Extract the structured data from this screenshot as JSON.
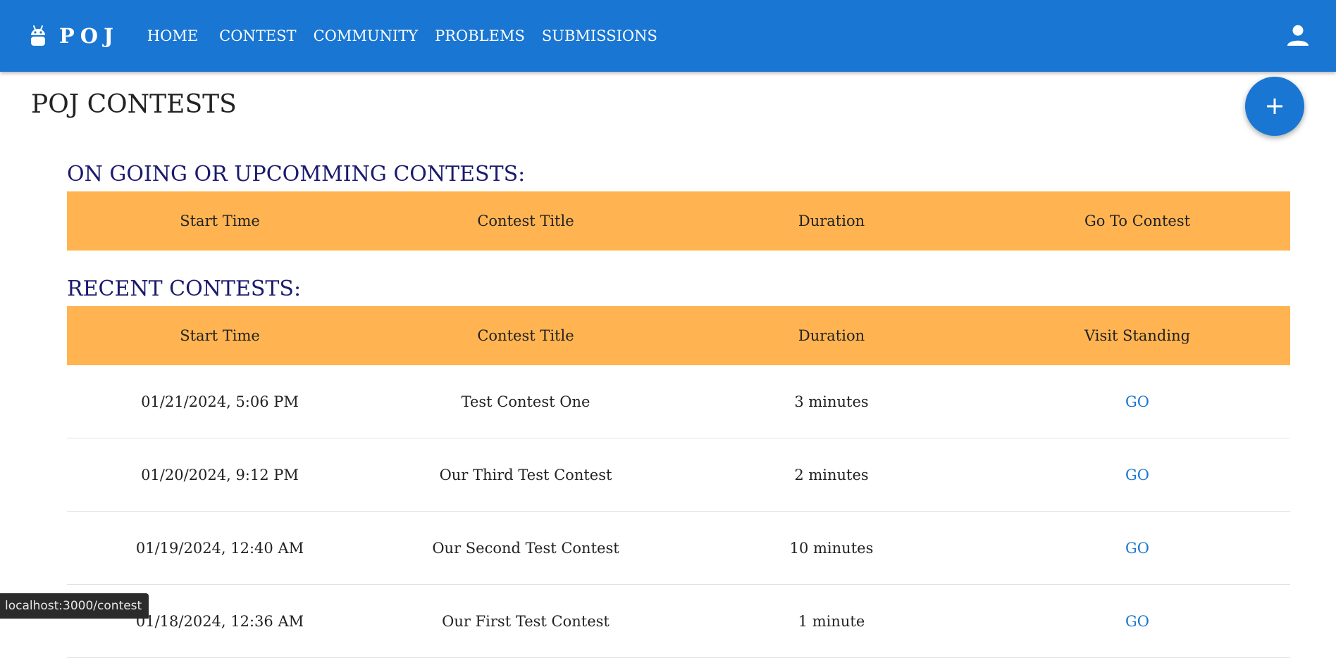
{
  "header": {
    "brand": "POJ",
    "nav": [
      "HOME",
      "CONTEST",
      "COMMUNITY",
      "PROBLEMS",
      "SUBMISSIONS"
    ]
  },
  "page": {
    "title": "POJ CONTESTS"
  },
  "upcoming": {
    "heading": "ON GOING OR UPCOMMING CONTESTS:",
    "columns": [
      "Start Time",
      "Contest Title",
      "Duration",
      "Go To Contest"
    ]
  },
  "recent": {
    "heading": "RECENT CONTESTS:",
    "columns": [
      "Start Time",
      "Contest Title",
      "Duration",
      "Visit Standing"
    ],
    "rows": [
      {
        "start": "01/21/2024, 5:06 PM",
        "title": "Test Contest One",
        "duration": "3 minutes",
        "link": "GO"
      },
      {
        "start": "01/20/2024, 9:12 PM",
        "title": "Our Third Test Contest",
        "duration": "2 minutes",
        "link": "GO"
      },
      {
        "start": "01/19/2024, 12:40 AM",
        "title": "Our Second Test Contest",
        "duration": "10 minutes",
        "link": "GO"
      },
      {
        "start": "01/18/2024, 12:36 AM",
        "title": "Our First Test Contest",
        "duration": "1 minute",
        "link": "GO"
      }
    ]
  },
  "status_bar": {
    "url": "localhost:3000/contest"
  },
  "colors": {
    "primary": "#1976d2",
    "header_row": "#ffb451",
    "section_heading": "#1a1a6e"
  }
}
